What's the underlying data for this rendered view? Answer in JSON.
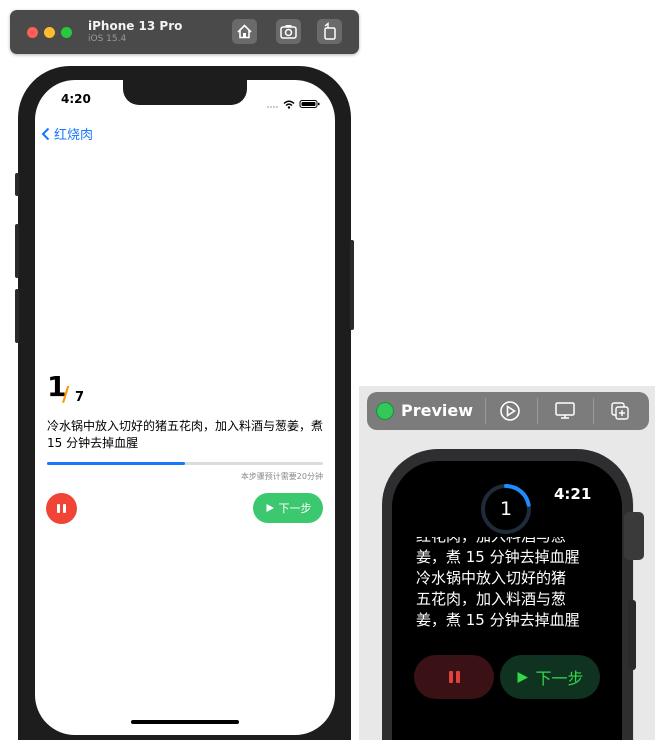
{
  "simulator": {
    "device_name": "iPhone 13 Pro",
    "os_version": "iOS 15.4"
  },
  "phone": {
    "status_time": "4:20",
    "back_label": "红烧肉",
    "step_current": "1",
    "step_separator": "/",
    "step_total": "7",
    "step_text": "冷水锅中放入切好的猪五花肉，加入料酒与葱姜，煮 15 分钟去掉血腥",
    "progress": 0.5,
    "estimate_text": "本步骤预计需要20分钟",
    "next_label": "下一步"
  },
  "preview": {
    "label": "Preview"
  },
  "watch": {
    "time": "4:21",
    "step_number": "1",
    "ring_progress": 0.22,
    "text_lines": [
      "红花肉，加入料酒与葱",
      "姜，煮 15 分钟去掉血腥",
      "冷水锅中放入切好的猪",
      "五花肉，加入料酒与葱",
      "姜，煮 15 分钟去掉血腥"
    ],
    "next_label": "下一步"
  },
  "colors": {
    "accent_blue": "#1677ff",
    "step_slash": "#ff9500",
    "pause_red": "#f04437",
    "next_green": "#3cc86e",
    "watch_green": "#32d74b"
  }
}
